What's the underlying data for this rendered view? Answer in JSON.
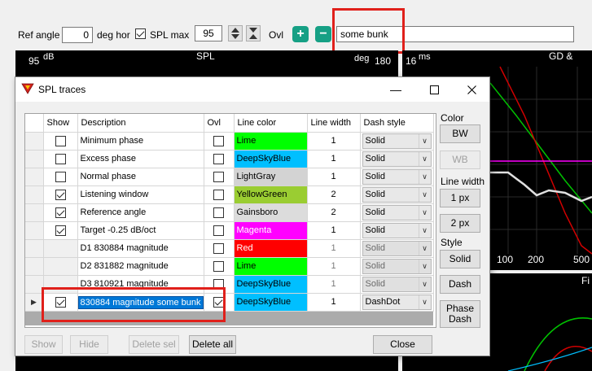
{
  "toolbar": {
    "ref_angle_label": "Ref angle",
    "ref_angle_value": "0",
    "deg_hor_label": "deg hor",
    "spl_max_label": "SPL max",
    "spl_max_value": "95",
    "ovl_label": "Ovl",
    "ovl_text_value": "some bunk"
  },
  "graph_left": {
    "ymax": "95",
    "yunit": "dB",
    "title": "SPL",
    "right_unit": "deg",
    "right_max": "180"
  },
  "graph_right": {
    "ymax": "16",
    "yunit": "ms",
    "title": "GD &",
    "x_ticks": [
      "100",
      "200",
      "500"
    ],
    "bottom_title": "Fi"
  },
  "dialog": {
    "title": "SPL traces",
    "columns": {
      "show": "Show",
      "description": "Description",
      "ovl": "Ovl",
      "line_color": "Line color",
      "line_width": "Line width",
      "dash_style": "Dash style"
    },
    "rows": [
      {
        "show": false,
        "show_enabled": true,
        "description": "Minimum phase",
        "ovl": false,
        "color_name": "Lime",
        "color": "#00ff00",
        "text_color": "#000000",
        "width": "1",
        "width_dim": false,
        "dash": "Solid",
        "dash_disabled": false
      },
      {
        "show": false,
        "show_enabled": true,
        "description": "Excess phase",
        "ovl": false,
        "color_name": "DeepSkyBlue",
        "color": "#00bfff",
        "text_color": "#000000",
        "width": "1",
        "width_dim": false,
        "dash": "Solid",
        "dash_disabled": false
      },
      {
        "show": false,
        "show_enabled": true,
        "description": "Normal phase",
        "ovl": false,
        "color_name": "LightGray",
        "color": "#d3d3d3",
        "text_color": "#000000",
        "width": "1",
        "width_dim": false,
        "dash": "Solid",
        "dash_disabled": false
      },
      {
        "show": true,
        "show_enabled": true,
        "description": "Listening window",
        "ovl": false,
        "color_name": "YellowGreen",
        "color": "#9acd32",
        "text_color": "#000000",
        "width": "2",
        "width_dim": false,
        "dash": "Solid",
        "dash_disabled": false
      },
      {
        "show": true,
        "show_enabled": true,
        "description": "Reference angle",
        "ovl": false,
        "color_name": "Gainsboro",
        "color": "#dcdcdc",
        "text_color": "#000000",
        "width": "2",
        "width_dim": false,
        "dash": "Solid",
        "dash_disabled": false
      },
      {
        "show": true,
        "show_enabled": true,
        "description": "Target -0.25 dB/oct",
        "ovl": false,
        "color_name": "Magenta",
        "color": "#ff00ff",
        "text_color": "#ffffff",
        "width": "1",
        "width_dim": false,
        "dash": "Solid",
        "dash_disabled": false
      },
      {
        "show": null,
        "show_enabled": false,
        "description": "D1 830884 magnitude",
        "ovl": false,
        "color_name": "Red",
        "color": "#ff0000",
        "text_color": "#ffffff",
        "width": "1",
        "width_dim": true,
        "dash": "Solid",
        "dash_disabled": true
      },
      {
        "show": null,
        "show_enabled": false,
        "description": "D2 831882 magnitude",
        "ovl": false,
        "color_name": "Lime",
        "color": "#00ff00",
        "text_color": "#000000",
        "width": "1",
        "width_dim": true,
        "dash": "Solid",
        "dash_disabled": true
      },
      {
        "show": null,
        "show_enabled": false,
        "description": "D3 810921 magnitude",
        "ovl": false,
        "color_name": "DeepSkyBlue",
        "color": "#00bfff",
        "text_color": "#000000",
        "width": "1",
        "width_dim": true,
        "dash": "Solid",
        "dash_disabled": true
      },
      {
        "show": true,
        "show_enabled": true,
        "description": " 830884 magnitude some bunk",
        "ovl": true,
        "color_name": "DeepSkyBlue",
        "color": "#00bfff",
        "text_color": "#000000",
        "width": "1",
        "width_dim": false,
        "dash": "DashDot",
        "dash_disabled": false,
        "editing": true
      }
    ],
    "side": {
      "color_label": "Color",
      "bw": "BW",
      "wb": "WB",
      "line_width_label": "Line width",
      "one_px": "1 px",
      "two_px": "2 px",
      "style_label": "Style",
      "solid": "Solid",
      "dash": "Dash",
      "phase_dash": "Phase Dash"
    },
    "bottom": {
      "show": "Show",
      "hide": "Hide",
      "delete_sel": "Delete sel",
      "delete_all": "Delete all",
      "close": "Close"
    }
  },
  "highlight_color": "#e0201b"
}
